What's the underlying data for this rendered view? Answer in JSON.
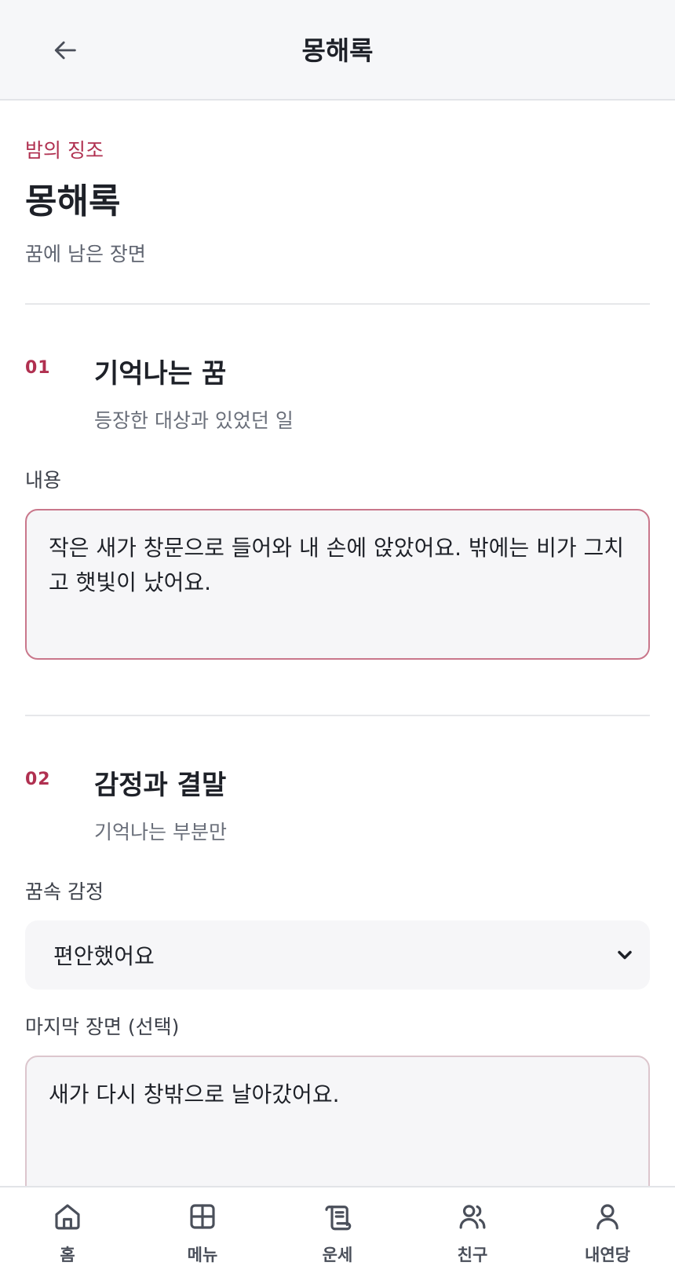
{
  "header": {
    "title": "몽해록"
  },
  "intro": {
    "eyebrow": "밤의 징조",
    "title": "몽해록",
    "subtitle": "꿈에 남은 장면"
  },
  "section1": {
    "number": "01",
    "title": "기억나는 꿈",
    "subtitle": "등장한 대상과 있었던 일",
    "field_label": "내용",
    "field_value": "작은 새가 창문으로 들어와 내 손에 앉았어요. 밖에는 비가 그치고 햇빛이 났어요."
  },
  "section2": {
    "number": "02",
    "title": "감정과 결말",
    "subtitle": "기억나는 부분만",
    "emotion_label": "꿈속 감정",
    "emotion_value": "편안했어요",
    "last_scene_label": "마지막 장면 (선택)",
    "last_scene_value": "새가 다시 창밖으로 날아갔어요."
  },
  "nav": {
    "items": [
      {
        "label": "홈",
        "icon": "home-icon"
      },
      {
        "label": "메뉴",
        "icon": "grid-icon"
      },
      {
        "label": "운세",
        "icon": "scroll-icon"
      },
      {
        "label": "친구",
        "icon": "friends-icon"
      },
      {
        "label": "내연당",
        "icon": "user-icon"
      }
    ]
  },
  "colors": {
    "accent": "#b03050",
    "text": "#1e2128",
    "muted": "#5f6470"
  }
}
